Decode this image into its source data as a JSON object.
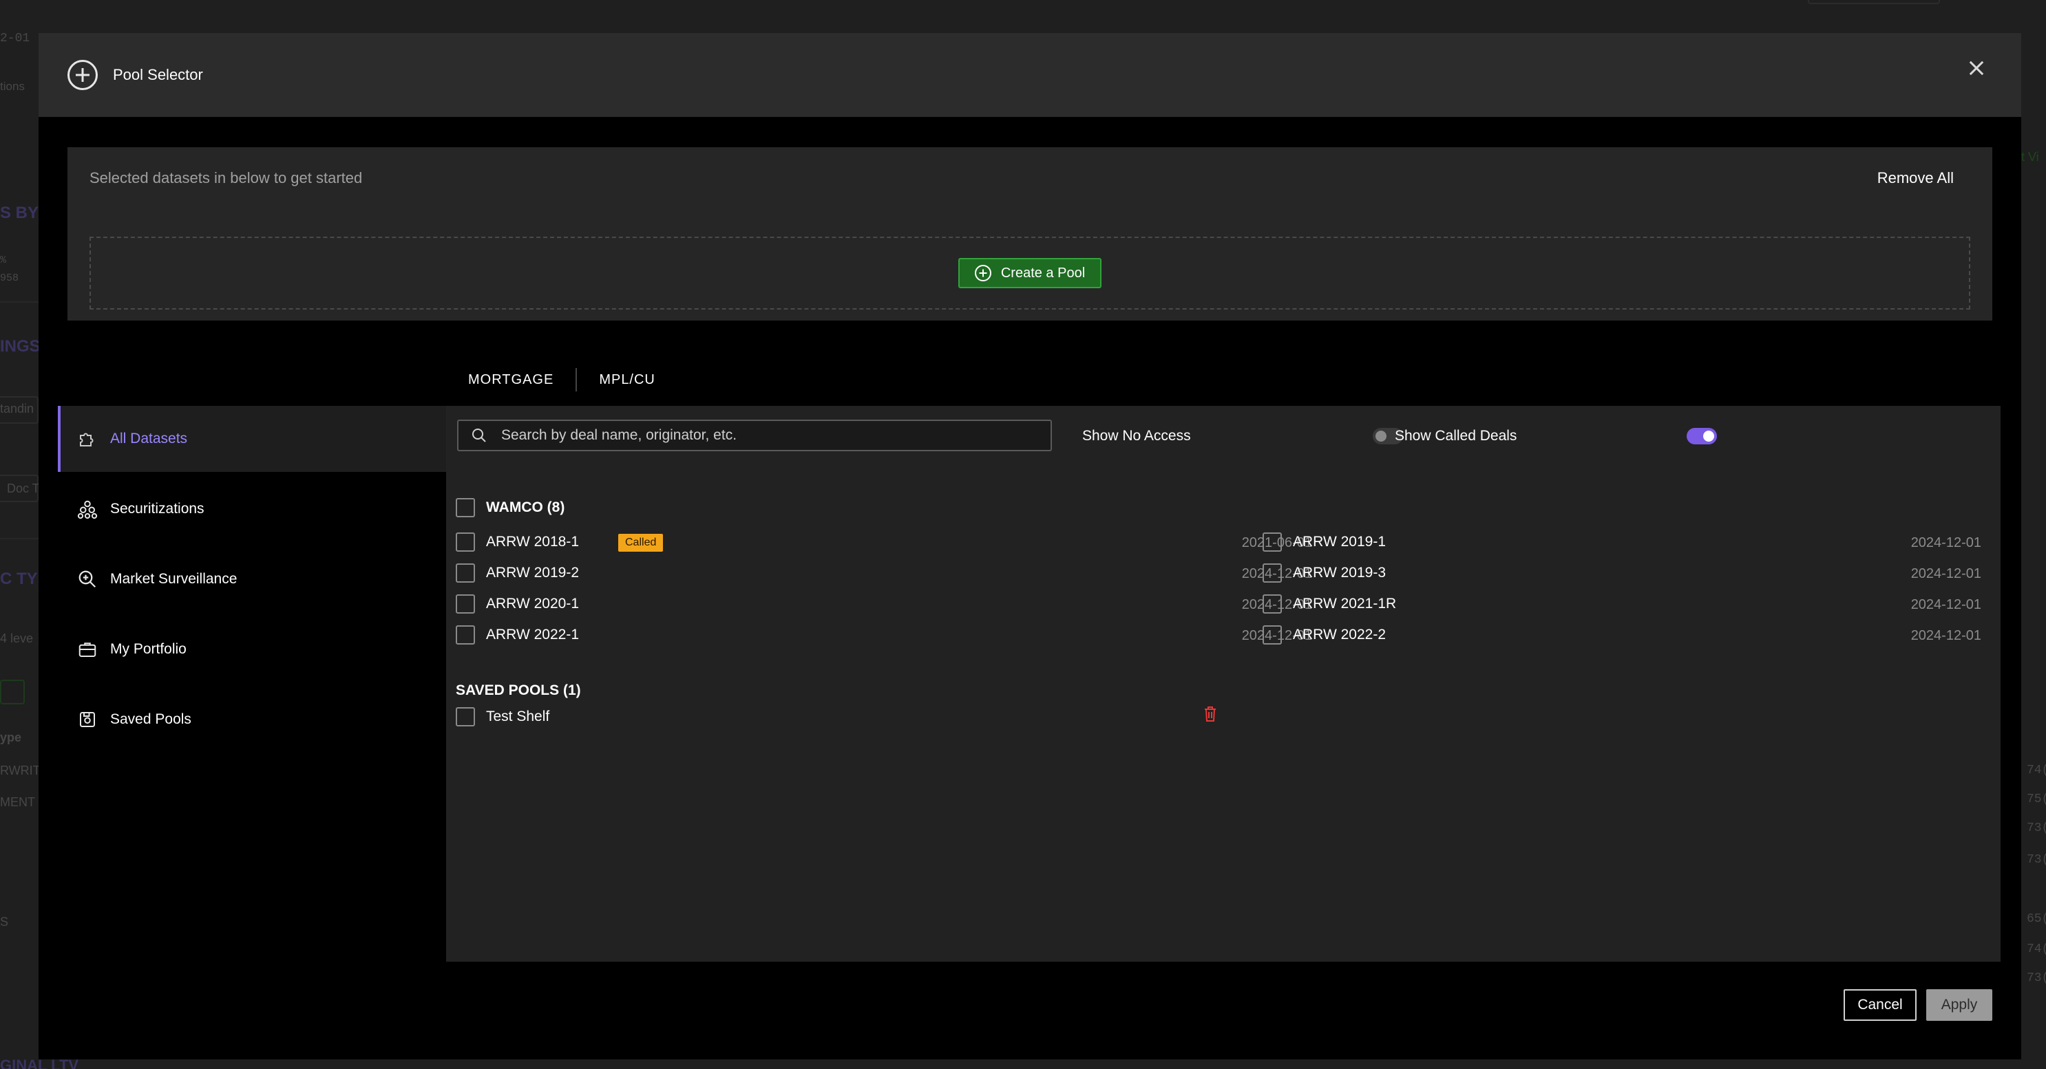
{
  "background_fragments": {
    "date": "2-01",
    "tions": "tions",
    "s_by": "S BY (",
    "pct": "%",
    "n958": "958",
    "ings": "INGS",
    "standin": "tandin",
    "doc": "Doc T",
    "c_typ": "C TYP",
    "levels": "4 leve",
    "ype": "ype",
    "rwrit": "RWRIT",
    "ment": "MENT",
    "s": "S",
    "ginal_ltv": "GINAL LTV",
    "right_vals": [
      "74(",
      "75(",
      "73(",
      "73(",
      "65(",
      "74(",
      "73("
    ],
    "right_label": "t Vi"
  },
  "modal": {
    "title": "Pool Selector",
    "close_icon": "close-icon",
    "selected_hint": "Selected datasets in below to get started",
    "remove_all": "Remove All",
    "create_pool": "Create a Pool"
  },
  "sidebar": {
    "items": [
      {
        "label": "All Datasets",
        "icon": "puzzle-icon",
        "active": true
      },
      {
        "label": "Securitizations",
        "icon": "stack-icon",
        "active": false
      },
      {
        "label": "Market Surveillance",
        "icon": "zoom-in-icon",
        "active": false
      },
      {
        "label": "My Portfolio",
        "icon": "briefcase-icon",
        "active": false
      },
      {
        "label": "Saved Pools",
        "icon": "save-icon",
        "active": false
      }
    ]
  },
  "tabs": [
    "MORTGAGE",
    "MPL/CU"
  ],
  "search": {
    "placeholder": "Search by deal name, originator, etc.",
    "value": ""
  },
  "toggles": {
    "show_no_access": {
      "label": "Show No Access",
      "on": false
    },
    "show_called": {
      "label": "Show Called Deals",
      "on": true
    }
  },
  "groups": {
    "wamco": {
      "header": "WAMCO (8)",
      "deals": [
        {
          "name": "ARRW 2018-1",
          "badge": "Called",
          "date": "2021-06-01"
        },
        {
          "name": "ARRW 2019-1",
          "badge": "",
          "date": "2024-12-01"
        },
        {
          "name": "ARRW 2019-2",
          "badge": "",
          "date": "2024-12-01"
        },
        {
          "name": "ARRW 2019-3",
          "badge": "",
          "date": "2024-12-01"
        },
        {
          "name": "ARRW 2020-1",
          "badge": "",
          "date": "2024-12-01"
        },
        {
          "name": "ARRW 2021-1R",
          "badge": "",
          "date": "2024-12-01"
        },
        {
          "name": "ARRW 2022-1",
          "badge": "",
          "date": "2024-12-01"
        },
        {
          "name": "ARRW 2022-2",
          "badge": "",
          "date": "2024-12-01"
        }
      ]
    },
    "saved_pools": {
      "header": "SAVED POOLS (1)",
      "items": [
        {
          "name": "Test Shelf"
        }
      ]
    }
  },
  "footer": {
    "cancel": "Cancel",
    "apply": "Apply"
  },
  "colors": {
    "accent": "#8169e6",
    "create_green": "#1e6b22",
    "badge_orange": "#f3a51a",
    "trash_red": "#e53935"
  }
}
